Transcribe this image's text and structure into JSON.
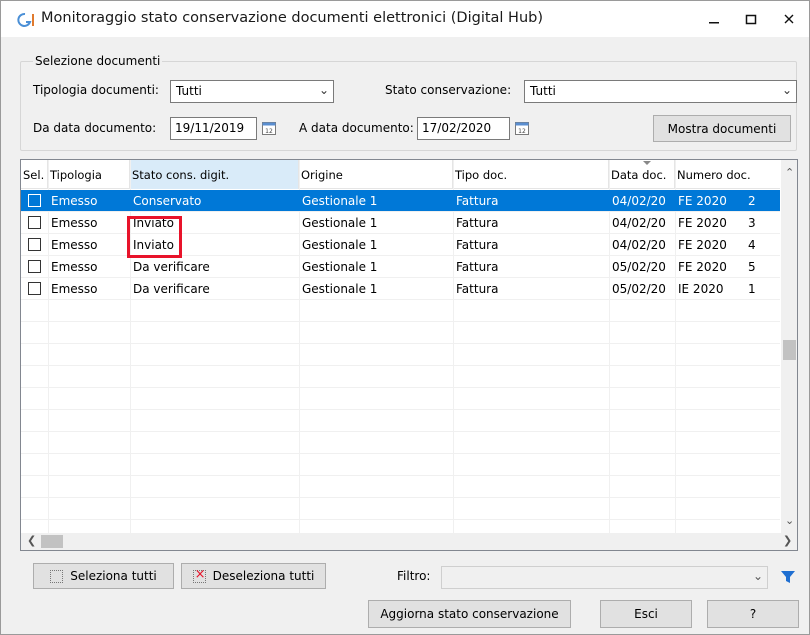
{
  "window": {
    "title": "Monitoraggio stato conservazione documenti elettronici (Digital Hub)",
    "icon": "gi-app-icon",
    "controls": {
      "minimize": "–",
      "maximize": "☐",
      "close": "✕"
    }
  },
  "selection": {
    "legend": "Selezione documenti",
    "tipologia_label": "Tipologia documenti:",
    "tipologia_value": "Tutti",
    "stato_label": "Stato conservazione:",
    "stato_value": "Tutti",
    "da_data_label": "Da data documento:",
    "da_data_value": "19/11/2019",
    "a_data_label": "A data documento:",
    "a_data_value": "17/02/2020",
    "show_button": "Mostra documenti"
  },
  "grid": {
    "headers": {
      "sel": "Sel.",
      "tipologia": "Tipologia",
      "stato": "Stato cons. digit.",
      "origine": "Origine",
      "tipo_doc": "Tipo doc.",
      "data_doc": "Data doc.",
      "numero_doc": "Numero doc."
    },
    "rows": [
      {
        "tipologia": "Emesso",
        "stato": "Conservato",
        "origine": "Gestionale 1",
        "tipo_doc": "Fattura",
        "data_doc": "04/02/20",
        "sezionale": "FE 2020",
        "numero": "2"
      },
      {
        "tipologia": "Emesso",
        "stato": "Inviato",
        "origine": "Gestionale 1",
        "tipo_doc": "Fattura",
        "data_doc": "04/02/20",
        "sezionale": "FE 2020",
        "numero": "3"
      },
      {
        "tipologia": "Emesso",
        "stato": "Inviato",
        "origine": "Gestionale 1",
        "tipo_doc": "Fattura",
        "data_doc": "04/02/20",
        "sezionale": "FE 2020",
        "numero": "4"
      },
      {
        "tipologia": "Emesso",
        "stato": "Da verificare",
        "origine": "Gestionale 1",
        "tipo_doc": "Fattura",
        "data_doc": "05/02/20",
        "sezionale": "FE 2020",
        "numero": "5"
      },
      {
        "tipologia": "Emesso",
        "stato": "Da verificare",
        "origine": "Gestionale 1",
        "tipo_doc": "Fattura",
        "data_doc": "05/02/20",
        "sezionale": "IE 2020",
        "numero": "1"
      }
    ],
    "selected_row": 0
  },
  "footer": {
    "select_all": "Seleziona tutti",
    "deselect_all": "Deseleziona tutti",
    "filter_label": "Filtro:",
    "filter_value": "",
    "update_button": "Aggiorna stato conservazione",
    "exit_button": "Esci",
    "help_button": "?"
  },
  "colors": {
    "selection": "#0078d7",
    "highlight": "#e8132a",
    "header_active": "#d9ebf9",
    "filter_icon": "#1f6fd1"
  }
}
